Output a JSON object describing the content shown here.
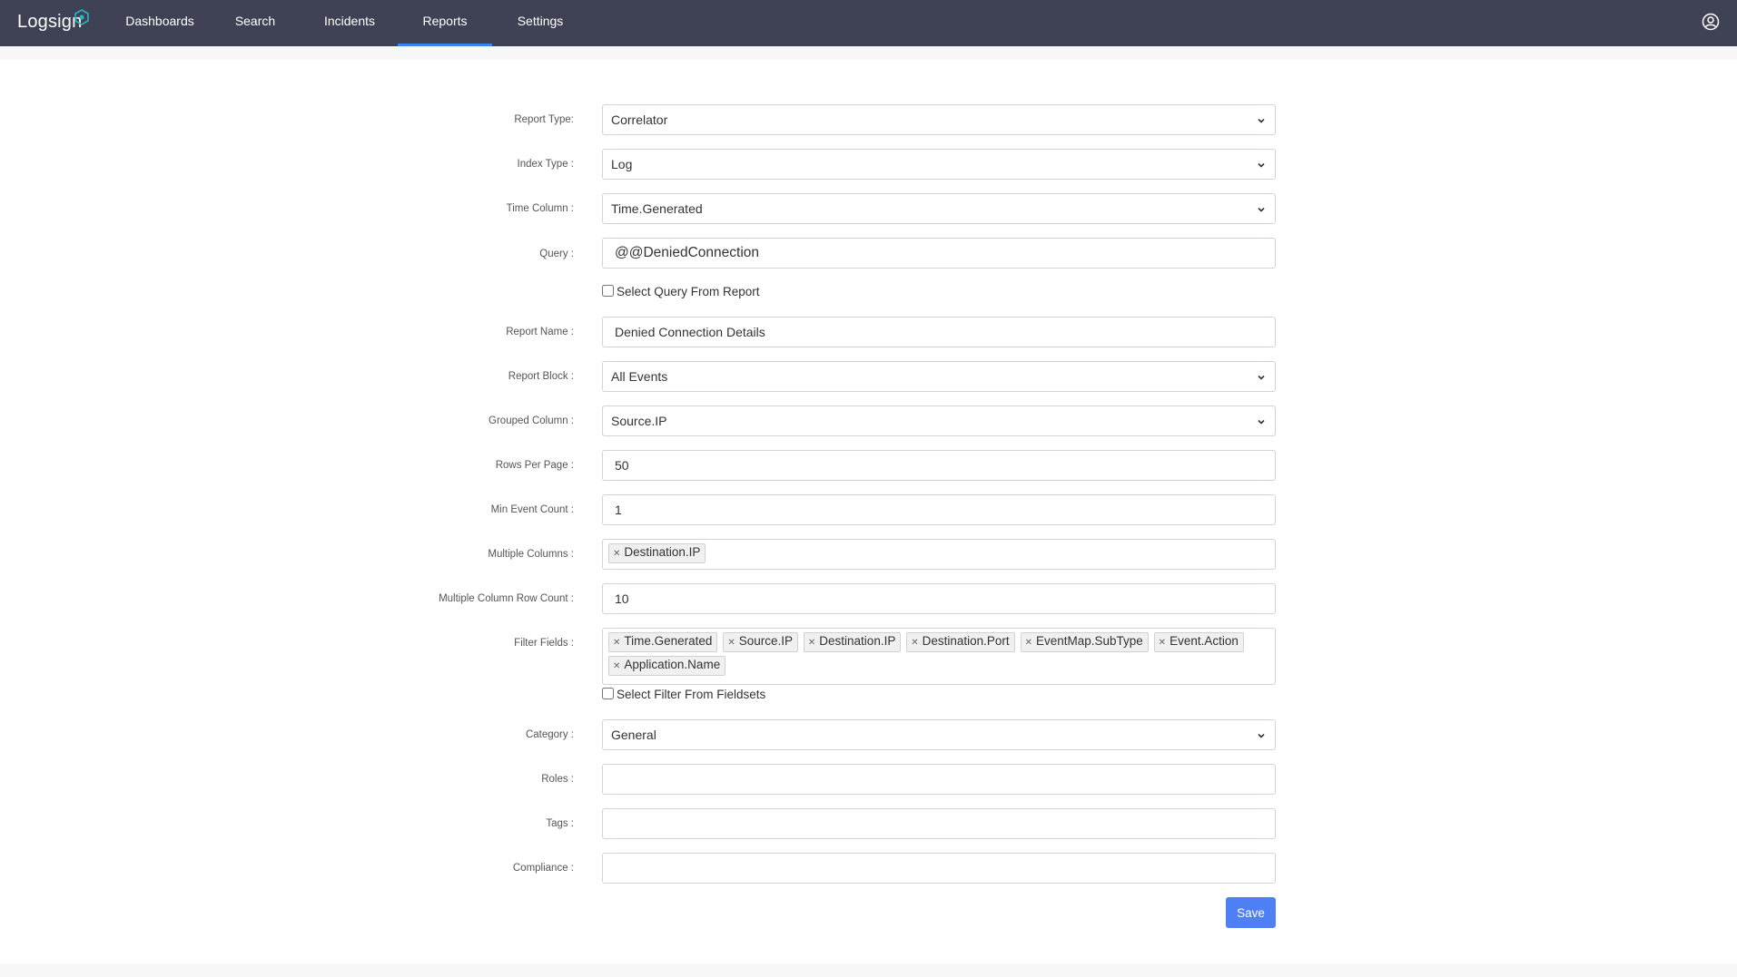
{
  "brand": {
    "name": "Logsign"
  },
  "nav": {
    "items": [
      {
        "label": "Dashboards"
      },
      {
        "label": "Search"
      },
      {
        "label": "Incidents"
      },
      {
        "label": "Reports"
      },
      {
        "label": "Settings"
      }
    ],
    "active": "Reports"
  },
  "form": {
    "report_type": {
      "label": "Report Type:",
      "value": "Correlator"
    },
    "index_type": {
      "label": "Index Type :",
      "value": "Log"
    },
    "time_column": {
      "label": "Time Column :",
      "value": "Time.Generated"
    },
    "query": {
      "label": "Query :",
      "value": "@@DeniedConnection",
      "checkbox_label": "Select Query From Report"
    },
    "report_name": {
      "label": "Report Name :",
      "value": "Denied Connection Details"
    },
    "report_block": {
      "label": "Report Block :",
      "value": "All Events"
    },
    "grouped_column": {
      "label": "Grouped Column :",
      "value": "Source.IP"
    },
    "rows_per_page": {
      "label": "Rows Per Page :",
      "value": "50"
    },
    "min_event_count": {
      "label": "Min Event Count :",
      "value": "1"
    },
    "multiple_columns": {
      "label": "Multiple Columns :",
      "tags": [
        "Destination.IP"
      ]
    },
    "multiple_column_row_count": {
      "label": "Multiple Column Row Count :",
      "value": "10"
    },
    "filter_fields": {
      "label": "Filter Fields :",
      "tags": [
        "Time.Generated",
        "Source.IP",
        "Destination.IP",
        "Destination.Port",
        "EventMap.SubType",
        "Event.Action",
        "Application.Name"
      ],
      "checkbox_label": "Select Filter From Fieldsets"
    },
    "category": {
      "label": "Category :",
      "value": "General"
    },
    "roles": {
      "label": "Roles :",
      "value": ""
    },
    "tags": {
      "label": "Tags :",
      "value": ""
    },
    "compliance": {
      "label": "Compliance :",
      "value": ""
    },
    "save_label": "Save"
  },
  "colors": {
    "topbar": "#3f4254",
    "accent": "#3b82f6",
    "save_button": "#4f7ff5"
  },
  "icons": {
    "user": "user-circle-icon",
    "dropdown": "chevron-down-icon",
    "tag_remove": "close-icon"
  }
}
